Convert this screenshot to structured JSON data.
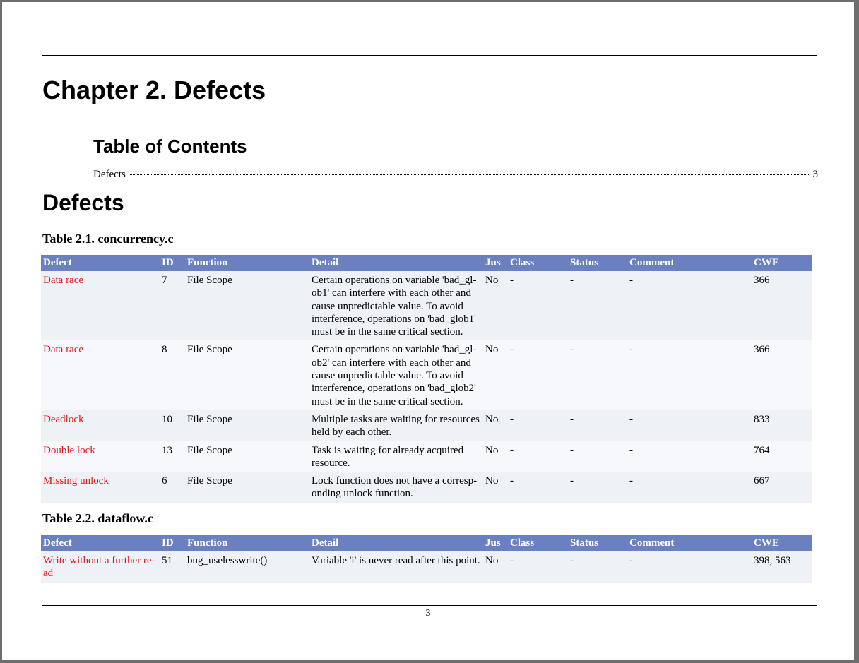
{
  "chapter_title": "Chapter 2. Defects",
  "toc": {
    "title": "Table of Contents",
    "entries": [
      {
        "label": "Defects",
        "page": "3"
      }
    ]
  },
  "section_title": "Defects",
  "columns": [
    "Defect",
    "ID",
    "Function",
    "Detail",
    "Jus",
    "Class",
    "Status",
    "Comment",
    "CWE"
  ],
  "tables": [
    {
      "caption": "Table 2.1. concurrency.c",
      "rows": [
        {
          "defect": "Data race",
          "id": "7",
          "function": "File Scope",
          "detail": "Certain operations on variable 'bad_gl­ob1' can interfere with each other and cause unpredictable value. To avoid interference, operations on 'bad_glob1' must be in the same critical section.",
          "jus": "No",
          "class": "-",
          "status": "-",
          "comment": "-",
          "cwe": "366"
        },
        {
          "defect": "Data race",
          "id": "8",
          "function": "File Scope",
          "detail": "Certain operations on variable 'bad_gl­ob2' can interfere with each other and cause unpredictable value. To avoid interference, operations on 'bad_glob2' must be in the same critical section.",
          "jus": "No",
          "class": "-",
          "status": "-",
          "comment": "-",
          "cwe": "366"
        },
        {
          "defect": "Deadlock",
          "id": "10",
          "function": "File Scope",
          "detail": "Multiple tasks are waiting for resourc­es held by each other.",
          "jus": "No",
          "class": "-",
          "status": "-",
          "comment": "-",
          "cwe": "833"
        },
        {
          "defect": "Double lock",
          "id": "13",
          "function": "File Scope",
          "detail": "Task is waiting for already acquired resource.",
          "jus": "No",
          "class": "-",
          "status": "-",
          "comment": "-",
          "cwe": "764"
        },
        {
          "defect": "Missing unlock",
          "id": "6",
          "function": "File Scope",
          "detail": "Lock function does not have a corresp­onding unlock function.",
          "jus": "No",
          "class": "-",
          "status": "-",
          "comment": "-",
          "cwe": "667"
        }
      ]
    },
    {
      "caption": "Table 2.2. dataflow.c",
      "rows": [
        {
          "defect": "Write without a further re­ad",
          "id": "51",
          "function": "bug_uselesswrite()",
          "detail": "Variable 'i' is never read after this poi­nt.",
          "jus": "No",
          "class": "-",
          "status": "-",
          "comment": "-",
          "cwe": "398, 563"
        }
      ]
    }
  ],
  "page_number": "3",
  "colors": {
    "header_bg": "#6b80c0",
    "defect_link": "#e0161c",
    "row_odd": "#eef1f6",
    "row_even": "#f7f8fb"
  }
}
